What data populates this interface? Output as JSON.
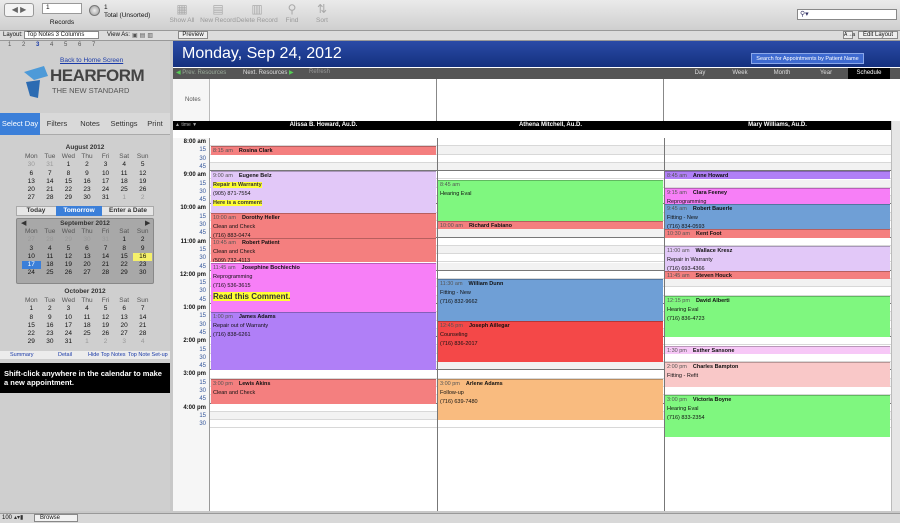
{
  "toolbar": {
    "records_value": "1",
    "records_label": "Records",
    "total_count": "1",
    "total_label": "Total (Unsorted)",
    "buttons": [
      "Show All",
      "New Record",
      "Delete Record",
      "Find",
      "Sort"
    ]
  },
  "statusbar": {
    "layout_label": "Layout:",
    "layout_value": "Top Notes 3 Columns",
    "view_as_label": "View As:",
    "preview_label": "Preview",
    "edit_layout_label": "Edit Layout",
    "aa_label": "A→a"
  },
  "sidebar": {
    "page_numbers": [
      "1",
      "2",
      "3",
      "4",
      "5",
      "6",
      "7"
    ],
    "back_link": "Back to Home Screen",
    "logo_main": "HEARFORM",
    "logo_sub": "THE NEW STANDARD",
    "tabs": [
      "Select Day",
      "Filters",
      "Notes",
      "Settings",
      "Print"
    ],
    "months": [
      {
        "title": "August 2012",
        "header": [
          "Mon",
          "Tue",
          "Wed",
          "Thu",
          "Fri",
          "Sat",
          "Sun"
        ],
        "days": [
          "30",
          "31",
          "1",
          "2",
          "3",
          "4",
          "5",
          "6",
          "7",
          "8",
          "9",
          "10",
          "11",
          "12",
          "13",
          "14",
          "15",
          "16",
          "17",
          "18",
          "19",
          "20",
          "21",
          "22",
          "23",
          "24",
          "25",
          "26",
          "27",
          "28",
          "29",
          "30",
          "31",
          "1",
          "2"
        ]
      },
      {
        "title": "September 2012",
        "header": [
          "Mon",
          "Tue",
          "Wed",
          "Thu",
          "Fri",
          "Sat",
          "Sun"
        ],
        "days": [
          "27",
          "28",
          "29",
          "30",
          "31",
          "1",
          "2",
          "3",
          "4",
          "5",
          "6",
          "7",
          "8",
          "9",
          "10",
          "11",
          "12",
          "13",
          "14",
          "15",
          "16",
          "17",
          "18",
          "19",
          "20",
          "21",
          "22",
          "23",
          "24",
          "25",
          "26",
          "27",
          "28",
          "29",
          "30"
        ]
      },
      {
        "title": "October 2012",
        "header": [
          "Mon",
          "Tue",
          "Wed",
          "Thu",
          "Fri",
          "Sat",
          "Sun"
        ],
        "days": [
          "1",
          "2",
          "3",
          "4",
          "5",
          "6",
          "7",
          "8",
          "9",
          "10",
          "11",
          "12",
          "13",
          "14",
          "15",
          "16",
          "17",
          "18",
          "19",
          "20",
          "21",
          "22",
          "23",
          "24",
          "25",
          "26",
          "27",
          "28",
          "29",
          "30",
          "31",
          "1",
          "2",
          "3",
          "4"
        ]
      }
    ],
    "day_buttons": [
      "Today",
      "Tomorrow",
      "Enter a Date"
    ],
    "bottom_links": [
      "Summary",
      "Detail",
      "Hide Top Notes",
      "Top Note Set-up"
    ],
    "hint": "Shift-click anywhere in the calendar to make a new appointment."
  },
  "header": {
    "date": "Monday, Sep 24, 2012",
    "search_button": "Search for Appointments by Patient Name",
    "nav": [
      "Prev. Resources",
      "Next. Resources",
      "Refresh"
    ],
    "views": [
      "Day",
      "Week",
      "Month",
      "Year",
      "Schedule"
    ],
    "notes_label": "Notes",
    "time_label": "time"
  },
  "providers": [
    "Alissa B. Howard, Au.D.",
    "Athena Mitchell, Au.D.",
    "Mary Williams, Au.D."
  ],
  "hours": [
    "8:00 am",
    "15",
    "30",
    "45",
    "9:00 am",
    "15",
    "30",
    "45",
    "10:00 am",
    "15",
    "30",
    "45",
    "11:00 am",
    "15",
    "30",
    "45",
    "12:00 pm",
    "15",
    "30",
    "45",
    "1:00 pm",
    "15",
    "30",
    "45",
    "2:00 pm",
    "15",
    "30",
    "45",
    "3:00 pm",
    "15",
    "30",
    "45",
    "4:00 pm",
    "15",
    "30"
  ],
  "appointments": [
    {
      "col": 0,
      "start": 1,
      "span": 1,
      "color": "#f47f7f",
      "lines": [
        {
          "t": "8:15 am",
          "n": "Rosina Clark"
        }
      ]
    },
    {
      "col": 0,
      "start": 4,
      "span": 5,
      "color": "#e2c8f8",
      "lines": [
        {
          "t": "9:00 am",
          "n": "Eugene Belz"
        },
        {
          "x": "Repair in Warranty",
          "hl": 1
        },
        {
          "x": "(905) 871-7554"
        },
        {
          "x": "Here is a comment",
          "hl": 1
        }
      ]
    },
    {
      "col": 0,
      "start": 9,
      "span": 3,
      "color": "#f47f7f",
      "lines": [
        {
          "t": "10:00 am",
          "n": "Dorothy Heller"
        },
        {
          "x": "Clean and Check"
        },
        {
          "x": "(716) 883-0474"
        }
      ]
    },
    {
      "col": 0,
      "start": 12,
      "span": 3,
      "color": "#f47f7f",
      "lines": [
        {
          "t": "10:45 am",
          "n": "Robert Patient"
        },
        {
          "x": "Clean and Check"
        },
        {
          "x": "(509) 732-4113"
        }
      ]
    },
    {
      "col": 0,
      "start": 15,
      "span": 6,
      "color": "#f77ff7",
      "lines": [
        {
          "t": "11:45 am",
          "n": "Josephine Bochiechio"
        },
        {
          "x": "Reprogramming"
        },
        {
          "x": "(716) 536-3615"
        }
      ],
      "comment": "Read this Comment."
    },
    {
      "col": 0,
      "start": 21,
      "span": 7,
      "color": "#b07ff7",
      "lines": [
        {
          "t": "1:00 pm",
          "n": "James Adams"
        },
        {
          "x": "Repair out of Warranty"
        },
        {
          "x": "(716) 838-6261"
        }
      ]
    },
    {
      "col": 0,
      "start": 29,
      "span": 3,
      "color": "#f47f7f",
      "lines": [
        {
          "t": "3:00 pm",
          "n": "Lewis Akins"
        },
        {
          "x": "Clean and Check"
        }
      ]
    },
    {
      "col": 1,
      "start": 5,
      "span": 5,
      "color": "#7ff77f",
      "lines": [
        {
          "t": "8:45 am",
          "n": ""
        },
        {
          "x": "Hearing Eval"
        }
      ]
    },
    {
      "col": 1,
      "start": 10,
      "span": 1,
      "color": "#f47f7f",
      "lines": [
        {
          "t": "10:00 am",
          "n": "Richard Fabiano"
        }
      ]
    },
    {
      "col": 1,
      "start": 17,
      "span": 6,
      "color": "#6f9fd6",
      "lines": [
        {
          "t": "11:30 am",
          "n": "William Dunn"
        },
        {
          "x": "Fitting - New"
        },
        {
          "x": "(716) 832-9662"
        }
      ]
    },
    {
      "col": 1,
      "start": 22,
      "span": 5,
      "color": "#f44848",
      "lines": [
        {
          "t": "12:45 pm",
          "n": "Joseph Aillegar"
        },
        {
          "x": "Counseling"
        },
        {
          "x": "(716) 836-2017"
        }
      ]
    },
    {
      "col": 1,
      "start": 29,
      "span": 5,
      "color": "#f9bb7f",
      "lines": [
        {
          "t": "3:00 pm",
          "n": "Arlene Adams"
        },
        {
          "x": "Follow-up"
        },
        {
          "x": "(716) 639-7480"
        }
      ]
    },
    {
      "col": 2,
      "start": 4,
      "span": 1,
      "color": "#b07ff7",
      "lines": [
        {
          "t": "8:45 am",
          "n": "Anne Howard"
        }
      ]
    },
    {
      "col": 2,
      "start": 6,
      "span": 2,
      "color": "#f77ff7",
      "lines": [
        {
          "t": "9:15 am",
          "n": "Clara Feeney"
        },
        {
          "x": "Reprogramming"
        }
      ]
    },
    {
      "col": 2,
      "start": 8,
      "span": 3,
      "color": "#6f9fd6",
      "lines": [
        {
          "t": "9:45 am",
          "n": "Robert Bauerle"
        },
        {
          "x": "Fitting - New"
        },
        {
          "x": "(716) 834-0593"
        }
      ]
    },
    {
      "col": 2,
      "start": 11,
      "span": 1,
      "color": "#f47f7f",
      "lines": [
        {
          "t": "10:30 am",
          "n": "Kent Foot"
        }
      ]
    },
    {
      "col": 2,
      "start": 13,
      "span": 3,
      "color": "#e2c8f8",
      "lines": [
        {
          "t": "11:00 am",
          "n": "Wallace Kresz"
        },
        {
          "x": "Repair in Warranty"
        },
        {
          "x": "(716) 693-4366"
        }
      ]
    },
    {
      "col": 2,
      "start": 16,
      "span": 1,
      "color": "#f47f7f",
      "lines": [
        {
          "t": "11:45 am",
          "n": "Steven Houck"
        }
      ]
    },
    {
      "col": 2,
      "start": 19,
      "span": 5,
      "color": "#7ff77f",
      "lines": [
        {
          "t": "12:15 pm",
          "n": "David Alberti"
        },
        {
          "x": "Hearing Eval"
        },
        {
          "x": "(716) 836-4723"
        }
      ]
    },
    {
      "col": 2,
      "start": 25,
      "span": 1,
      "color": "#f7c8f7",
      "lines": [
        {
          "t": "1:30 pm",
          "n": "Esther Sansone"
        }
      ]
    },
    {
      "col": 2,
      "start": 27,
      "span": 3,
      "color": "#f9c8c8",
      "lines": [
        {
          "t": "2:00 pm",
          "n": "Charles Bampton"
        },
        {
          "x": "Fitting - Refit"
        }
      ]
    },
    {
      "col": 2,
      "start": 31,
      "span": 5,
      "color": "#7ff77f",
      "lines": [
        {
          "t": "3:00 pm",
          "n": "Victoria Boyne"
        },
        {
          "x": "Hearing Eval"
        },
        {
          "x": "(716) 833-2354"
        }
      ]
    }
  ],
  "bottombar": {
    "zoom": "100",
    "mode": "Browse"
  },
  "colors": {
    "header_blue": "#1d3a8f",
    "select_blue": "#3b7fd9"
  }
}
